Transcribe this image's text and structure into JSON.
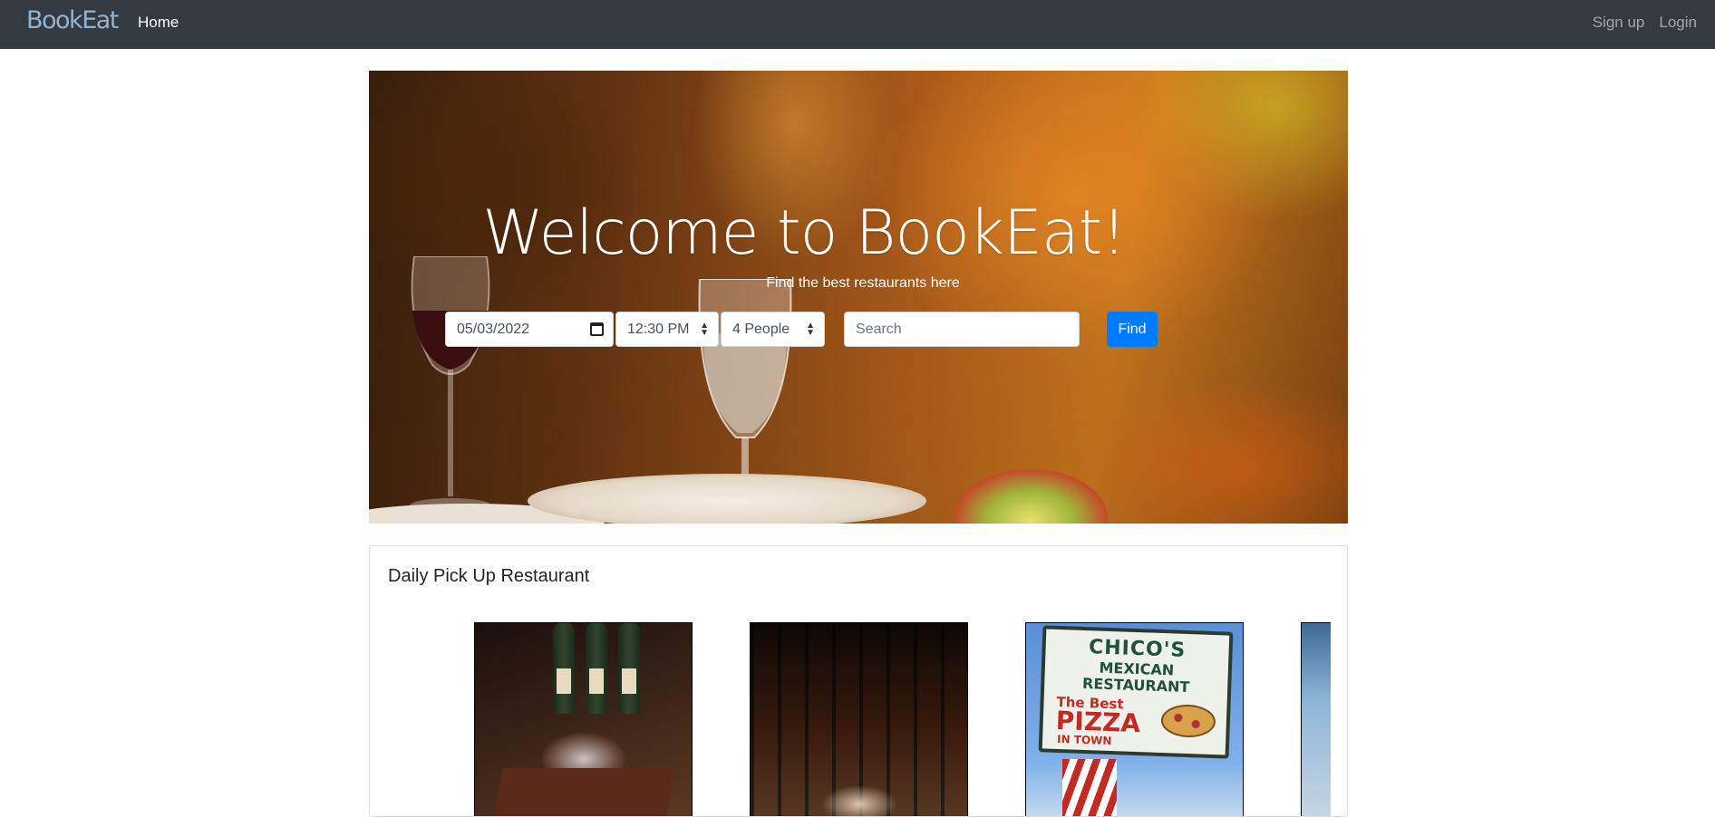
{
  "navbar": {
    "brand": "BookEat",
    "home": "Home",
    "signup": "Sign up",
    "login": "Login"
  },
  "hero": {
    "title": "Welcome to BookEat!",
    "subtitle": "Find the best restaurants here",
    "date_value": "05/03/2022",
    "time_value": "12:30 PM",
    "people_value": "4 People",
    "search_placeholder": "Search",
    "find_label": "Find"
  },
  "daily": {
    "title": "Daily Pick Up Restaurant",
    "sign_text": {
      "line1": "CHICO'S",
      "line2": "MEXICAN",
      "line3": "RESTAURANT",
      "line4": "The Best",
      "line5": "PIZZA",
      "line6": "IN TOWN"
    }
  },
  "colors": {
    "navbar": "#343a40",
    "primary": "#007bff"
  }
}
